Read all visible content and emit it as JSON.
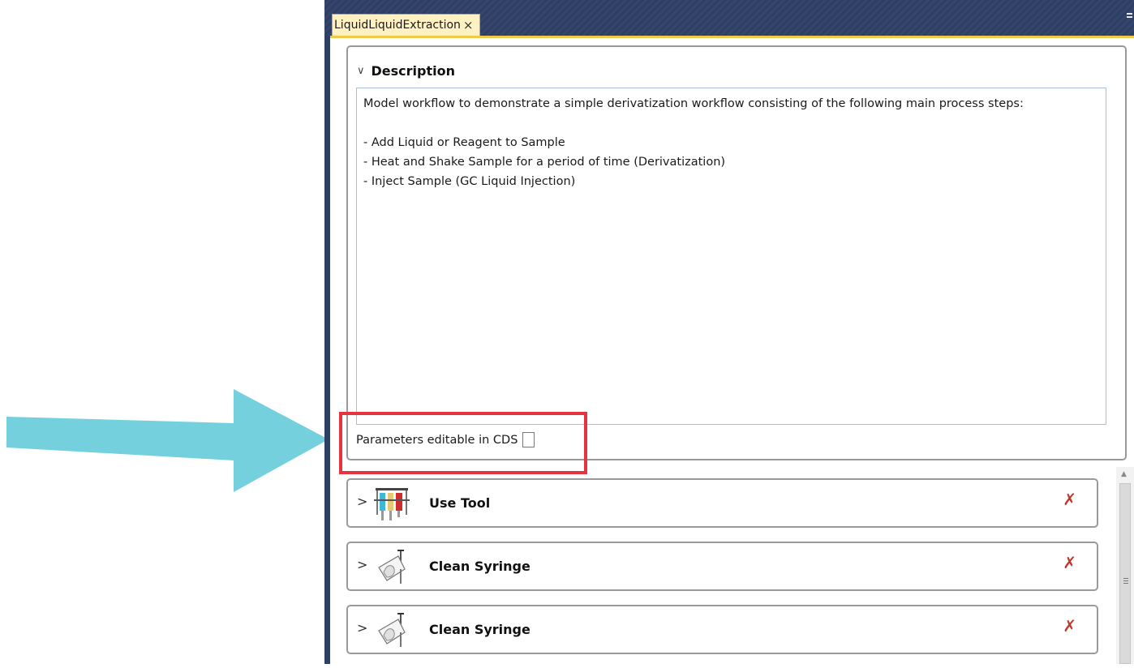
{
  "tab": {
    "title": "LiquidLiquidExtraction",
    "close": "×"
  },
  "description": {
    "title": "Description",
    "text": "Model workflow to demonstrate a simple derivatization workflow consisting of the following main process steps:\n\n- Add Liquid or Reagent to Sample\n- Heat and Shake Sample for a period of time (Derivatization)\n- Inject Sample (GC Liquid Injection)"
  },
  "params_label": "Parameters editable in CDS",
  "params_editable": false,
  "steps": [
    {
      "label": "Use Tool",
      "icon": "syringe-tools-icon"
    },
    {
      "label": "Clean Syringe",
      "icon": "clean-syringe-icon"
    },
    {
      "label": "Clean Syringe",
      "icon": "clean-syringe-icon"
    }
  ],
  "colors": {
    "arrow": "#73d0dc",
    "highlight": "#e5333f",
    "tab_bg": "#fff1c2",
    "header": "#2f3f63"
  }
}
